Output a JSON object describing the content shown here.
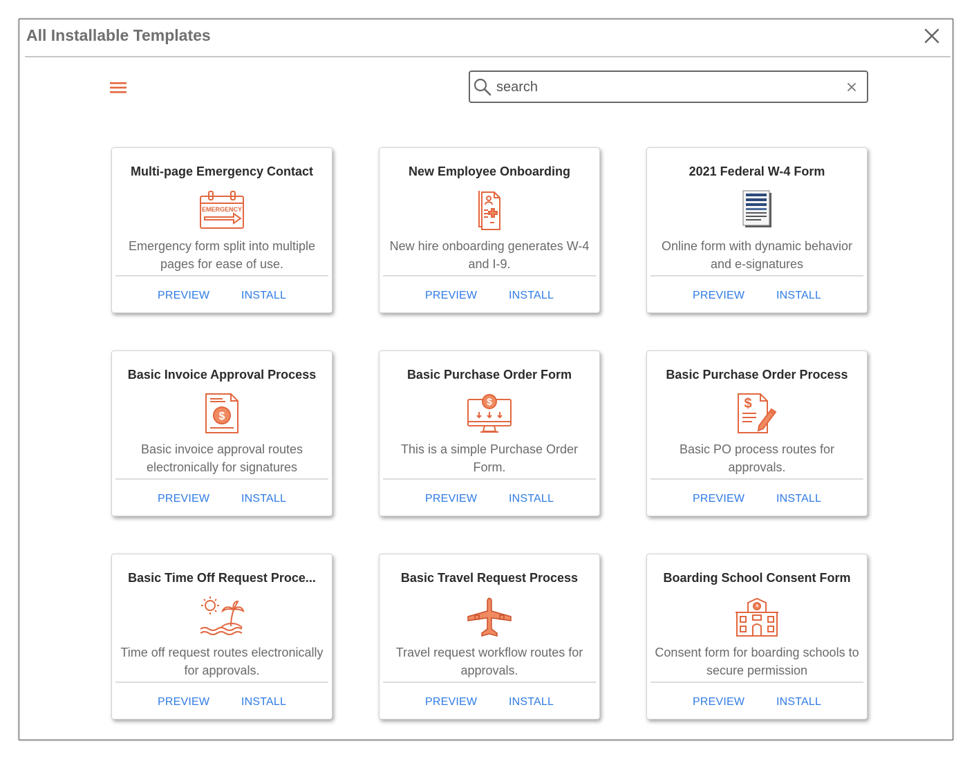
{
  "dialog": {
    "title": "All Installable Templates",
    "close_icon": "close-icon"
  },
  "toolbar": {
    "menu_icon": "hamburger-menu-icon",
    "search": {
      "placeholder": "search",
      "value": "",
      "icon": "search-icon",
      "clear_icon": "clear-icon"
    }
  },
  "colors": {
    "accent": "#e2673f",
    "link": "#2f7be5",
    "w4_icon": "#2d4a7a"
  },
  "templates": [
    {
      "title": "Multi-page Emergency Contact",
      "description": "Emergency form split into multiple pages for ease of use.",
      "icon": "emergency-calendar-icon",
      "icon_text": "EMERGENCY",
      "preview_label": "PREVIEW",
      "install_label": "INSTALL"
    },
    {
      "title": "New Employee Onboarding",
      "description": "New hire onboarding generates W-4 and I-9.",
      "icon": "onboarding-document-icon",
      "preview_label": "PREVIEW",
      "install_label": "INSTALL"
    },
    {
      "title": "2021 Federal W-4 Form",
      "description": "Online form with dynamic behavior and e-signatures",
      "icon": "w4-document-icon",
      "preview_label": "PREVIEW",
      "install_label": "INSTALL"
    },
    {
      "title": "Basic Invoice Approval Process",
      "description": "Basic invoice approval routes electronically for signatures",
      "icon": "invoice-icon",
      "preview_label": "PREVIEW",
      "install_label": "INSTALL"
    },
    {
      "title": "Basic Purchase Order Form",
      "description": "This is a simple Purchase Order Form.",
      "icon": "purchase-monitor-icon",
      "preview_label": "PREVIEW",
      "install_label": "INSTALL"
    },
    {
      "title": "Basic Purchase Order Process",
      "description": "Basic PO process routes for approvals.",
      "icon": "purchase-order-pen-icon",
      "preview_label": "PREVIEW",
      "install_label": "INSTALL"
    },
    {
      "title": "Basic Time Off Request Proce...",
      "description": "Time off request routes electronically for approvals.",
      "icon": "island-sun-icon",
      "preview_label": "PREVIEW",
      "install_label": "INSTALL"
    },
    {
      "title": "Basic Travel Request Process",
      "description": "Travel request workflow routes for approvals.",
      "icon": "airplane-icon",
      "preview_label": "PREVIEW",
      "install_label": "INSTALL"
    },
    {
      "title": "Boarding School Consent Form",
      "description": "Consent form for boarding schools to secure permission",
      "icon": "school-building-icon",
      "preview_label": "PREVIEW",
      "install_label": "INSTALL"
    }
  ]
}
